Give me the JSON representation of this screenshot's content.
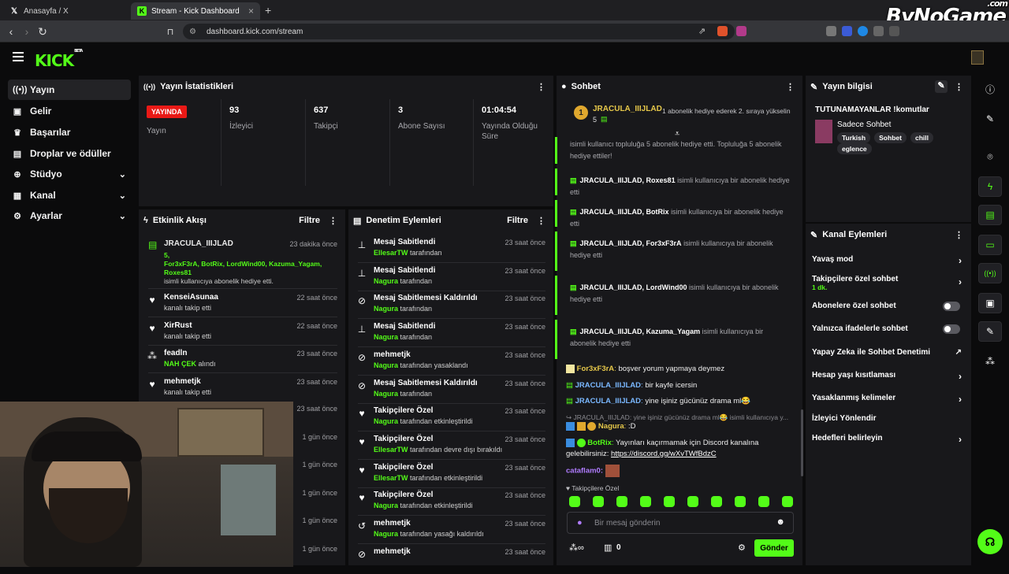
{
  "browser": {
    "tabs": [
      {
        "label": "Anasayfa / X"
      },
      {
        "label": "Stream - Kick Dashboard"
      }
    ],
    "url": "dashboard.kick.com/stream",
    "watermark": "ByNoGame",
    "watermark_suffix": ".com"
  },
  "app": {
    "logo": "KICK",
    "logo_badge": "BETA"
  },
  "sidebar": {
    "items": [
      {
        "label": "Yayın",
        "icon": "broadcast-icon"
      },
      {
        "label": "Gelir",
        "icon": "wallet-icon"
      },
      {
        "label": "Başarılar",
        "icon": "trophy-icon"
      },
      {
        "label": "Droplar ve ödüller",
        "icon": "gift-icon"
      },
      {
        "label": "Stüdyo",
        "icon": "studio-icon"
      },
      {
        "label": "Kanal",
        "icon": "people-icon"
      },
      {
        "label": "Ayarlar",
        "icon": "gear-icon"
      }
    ]
  },
  "stats": {
    "title": "Yayın İstatistikleri",
    "live_badge": "YAYINDA",
    "live_label": "Yayın",
    "items": [
      {
        "value": "93",
        "label": "İzleyici"
      },
      {
        "value": "637",
        "label": "Takipçi"
      },
      {
        "value": "3",
        "label": "Abone Sayısı"
      },
      {
        "value": "01:04:54",
        "label": "Yayında Olduğu Süre"
      }
    ]
  },
  "activity": {
    "title": "Etkinlik Akışı",
    "filter": "Filtre",
    "first": {
      "user": "JRACULA_IIIJLAD",
      "time": "23 dakika önce",
      "line2": "5,",
      "line3": "For3xF3rA, BotRix, LordWind00, Kazuma_Yagam,",
      "line4": "Roxes81",
      "line5": "isimli kullanıcıya abonelik hediye etti."
    },
    "items": [
      {
        "user": "KenseiAsunaa",
        "text": "kanalı takip etti",
        "time": "22 saat önce"
      },
      {
        "user": "XirRust",
        "text": "kanalı takip etti",
        "time": "22 saat önce"
      },
      {
        "user": "feadln",
        "highlight": "NAH ÇEK",
        "text": "alındı",
        "time": "23 saat önce"
      },
      {
        "user": "mehmetjk",
        "text": "kanalı takip etti",
        "time": "23 saat önce"
      }
    ],
    "hidden_times": [
      "23 saat önce",
      "1 gün önce",
      "1 gün önce",
      "1 gün önce",
      "1 gün önce",
      "1 gün önce"
    ]
  },
  "moderation": {
    "title": "Denetim Eylemleri",
    "filter": "Filtre",
    "items": [
      {
        "title": "Mesaj Sabitlendi",
        "mod": "EllesarTW",
        "suffix": "tarafından",
        "time": "23 saat önce"
      },
      {
        "title": "Mesaj Sabitlendi",
        "mod": "Nagura",
        "suffix": "tarafından",
        "time": "23 saat önce"
      },
      {
        "title": "Mesaj Sabitlemesi Kaldırıldı",
        "mod": "Nagura",
        "suffix": "tarafından",
        "time": "23 saat önce"
      },
      {
        "title": "Mesaj Sabitlendi",
        "mod": "Nagura",
        "suffix": "tarafından",
        "time": "23 saat önce"
      },
      {
        "title": "mehmetjk",
        "mod": "Nagura",
        "suffix": "tarafından yasaklandı",
        "time": "23 saat önce"
      },
      {
        "title": "Mesaj Sabitlemesi Kaldırıldı",
        "mod": "Nagura",
        "suffix": "tarafından",
        "time": "23 saat önce"
      },
      {
        "title": "Takipçilere Özel",
        "mod": "Nagura",
        "suffix": "tarafından etkinleştirildi",
        "time": "23 saat önce"
      },
      {
        "title": "Takipçilere Özel",
        "mod": "EllesarTW",
        "suffix": "tarafından devre dışı bırakıldı",
        "time": "23 saat önce"
      },
      {
        "title": "Takipçilere Özel",
        "mod": "EllesarTW",
        "suffix": "tarafından etkinleştirildi",
        "time": "23 saat önce"
      },
      {
        "title": "Takipçilere Özel",
        "mod": "Nagura",
        "suffix": "tarafından etkinleştirildi",
        "time": "23 saat önce"
      },
      {
        "title": "mehmetjk",
        "mod": "Nagura",
        "suffix": "tarafından yasağı kaldırıldı",
        "time": "23 saat önce"
      },
      {
        "title": "mehmetjk",
        "mod": "",
        "suffix": "",
        "time": "23 saat önce"
      }
    ]
  },
  "chat": {
    "title": "Sohbet",
    "pinned_user": "JRACULA_IIIJLAD",
    "pinned_count": "5",
    "pinned_rank": "1",
    "pinned_text": "1 abonelik hediye ederek 2. sıraya yükselin",
    "top_note": "isimli kullanıcı topluluğa 5 abonelik hediye etti. Topluluğa 5 abonelik hediye ettiler!",
    "gifts": [
      {
        "from": "JRACULA_IIIJLAD",
        "to": "Roxes81",
        "text": "isimli kullanıcıya bir abonelik hediye etti"
      },
      {
        "from": "JRACULA_IIIJLAD",
        "to": "BotRix",
        "text": "isimli kullanıcıya bir abonelik hediye etti"
      },
      {
        "from": "JRACULA_IIIJLAD",
        "to": "For3xF3rA",
        "text": "isimli kullanıcıya bir abonelik hediye etti"
      },
      {
        "from": "JRACULA_IIIJLAD",
        "to": "LordWind00",
        "text": "isimli kullanıcıya bir abonelik hediye etti"
      },
      {
        "from": "JRACULA_IIIJLAD",
        "to": "Kazuma_Yagam",
        "text": "isimli kullanıcıya bir abonelik hediye etti"
      }
    ],
    "messages": [
      {
        "user": "For3xF3rA",
        "text": "boşver yorum yapmaya deymez",
        "color": "#e6c84a"
      },
      {
        "user": "JRACULA_IIIJLAD",
        "text": "bir kayfe icersin",
        "color": "#7ab8ff"
      },
      {
        "user": "JRACULA_IIIJLAD",
        "text": "yine işiniz gücünüz drama ml😂",
        "color": "#7ab8ff"
      }
    ],
    "reply_hint": "JRACULA_IIIJLAD: yine işiniz gücünüz drama ml😂 isimli kullanıcıya y...",
    "nagura": {
      "user": "Nagura",
      "text": ":D",
      "color": "#e6c84a"
    },
    "botrix": {
      "user": "BotRix",
      "text": "Yayınları kaçırmamak için Discord kanalına gelebilirsiniz:",
      "link": "https://discord.gg/wXvTWfBdzC",
      "color": "#53fc18"
    },
    "cataflam": {
      "user": "cataflam0:",
      "color": "#b07cff"
    },
    "mode_label": "Takipçilere Özel",
    "input_placeholder": "Bir mesaj gönderin",
    "footer_count": "0",
    "send": "Gönder"
  },
  "stream_info": {
    "title": "Yayın bilgisi",
    "stream_title": "TUTUNAMAYANLAR !komutlar",
    "category": "Sadece Sohbet",
    "tags": [
      "Turkish",
      "Sohbet",
      "chill",
      "eglence"
    ]
  },
  "channel_actions": {
    "title": "Kanal Eylemleri",
    "items": [
      {
        "label": "Yavaş mod",
        "control": "chevron"
      },
      {
        "label": "Takipçilere özel sohbet",
        "sub": "1 dk.",
        "control": "chevron"
      },
      {
        "label": "Abonelere özel sohbet",
        "control": "toggle"
      },
      {
        "label": "Yalnızca ifadelerle sohbet",
        "control": "toggle"
      },
      {
        "label": "Yapay Zeka ile Sohbet Denetimi",
        "control": "external"
      },
      {
        "label": "Hesap yaşı kısıtlaması",
        "control": "chevron"
      },
      {
        "label": "Yasaklanmış kelimeler",
        "control": "chevron"
      },
      {
        "label": "İzleyici Yönlendir",
        "control": "none"
      },
      {
        "label": "Hedefleri belirleyin",
        "control": "chevron"
      }
    ]
  }
}
